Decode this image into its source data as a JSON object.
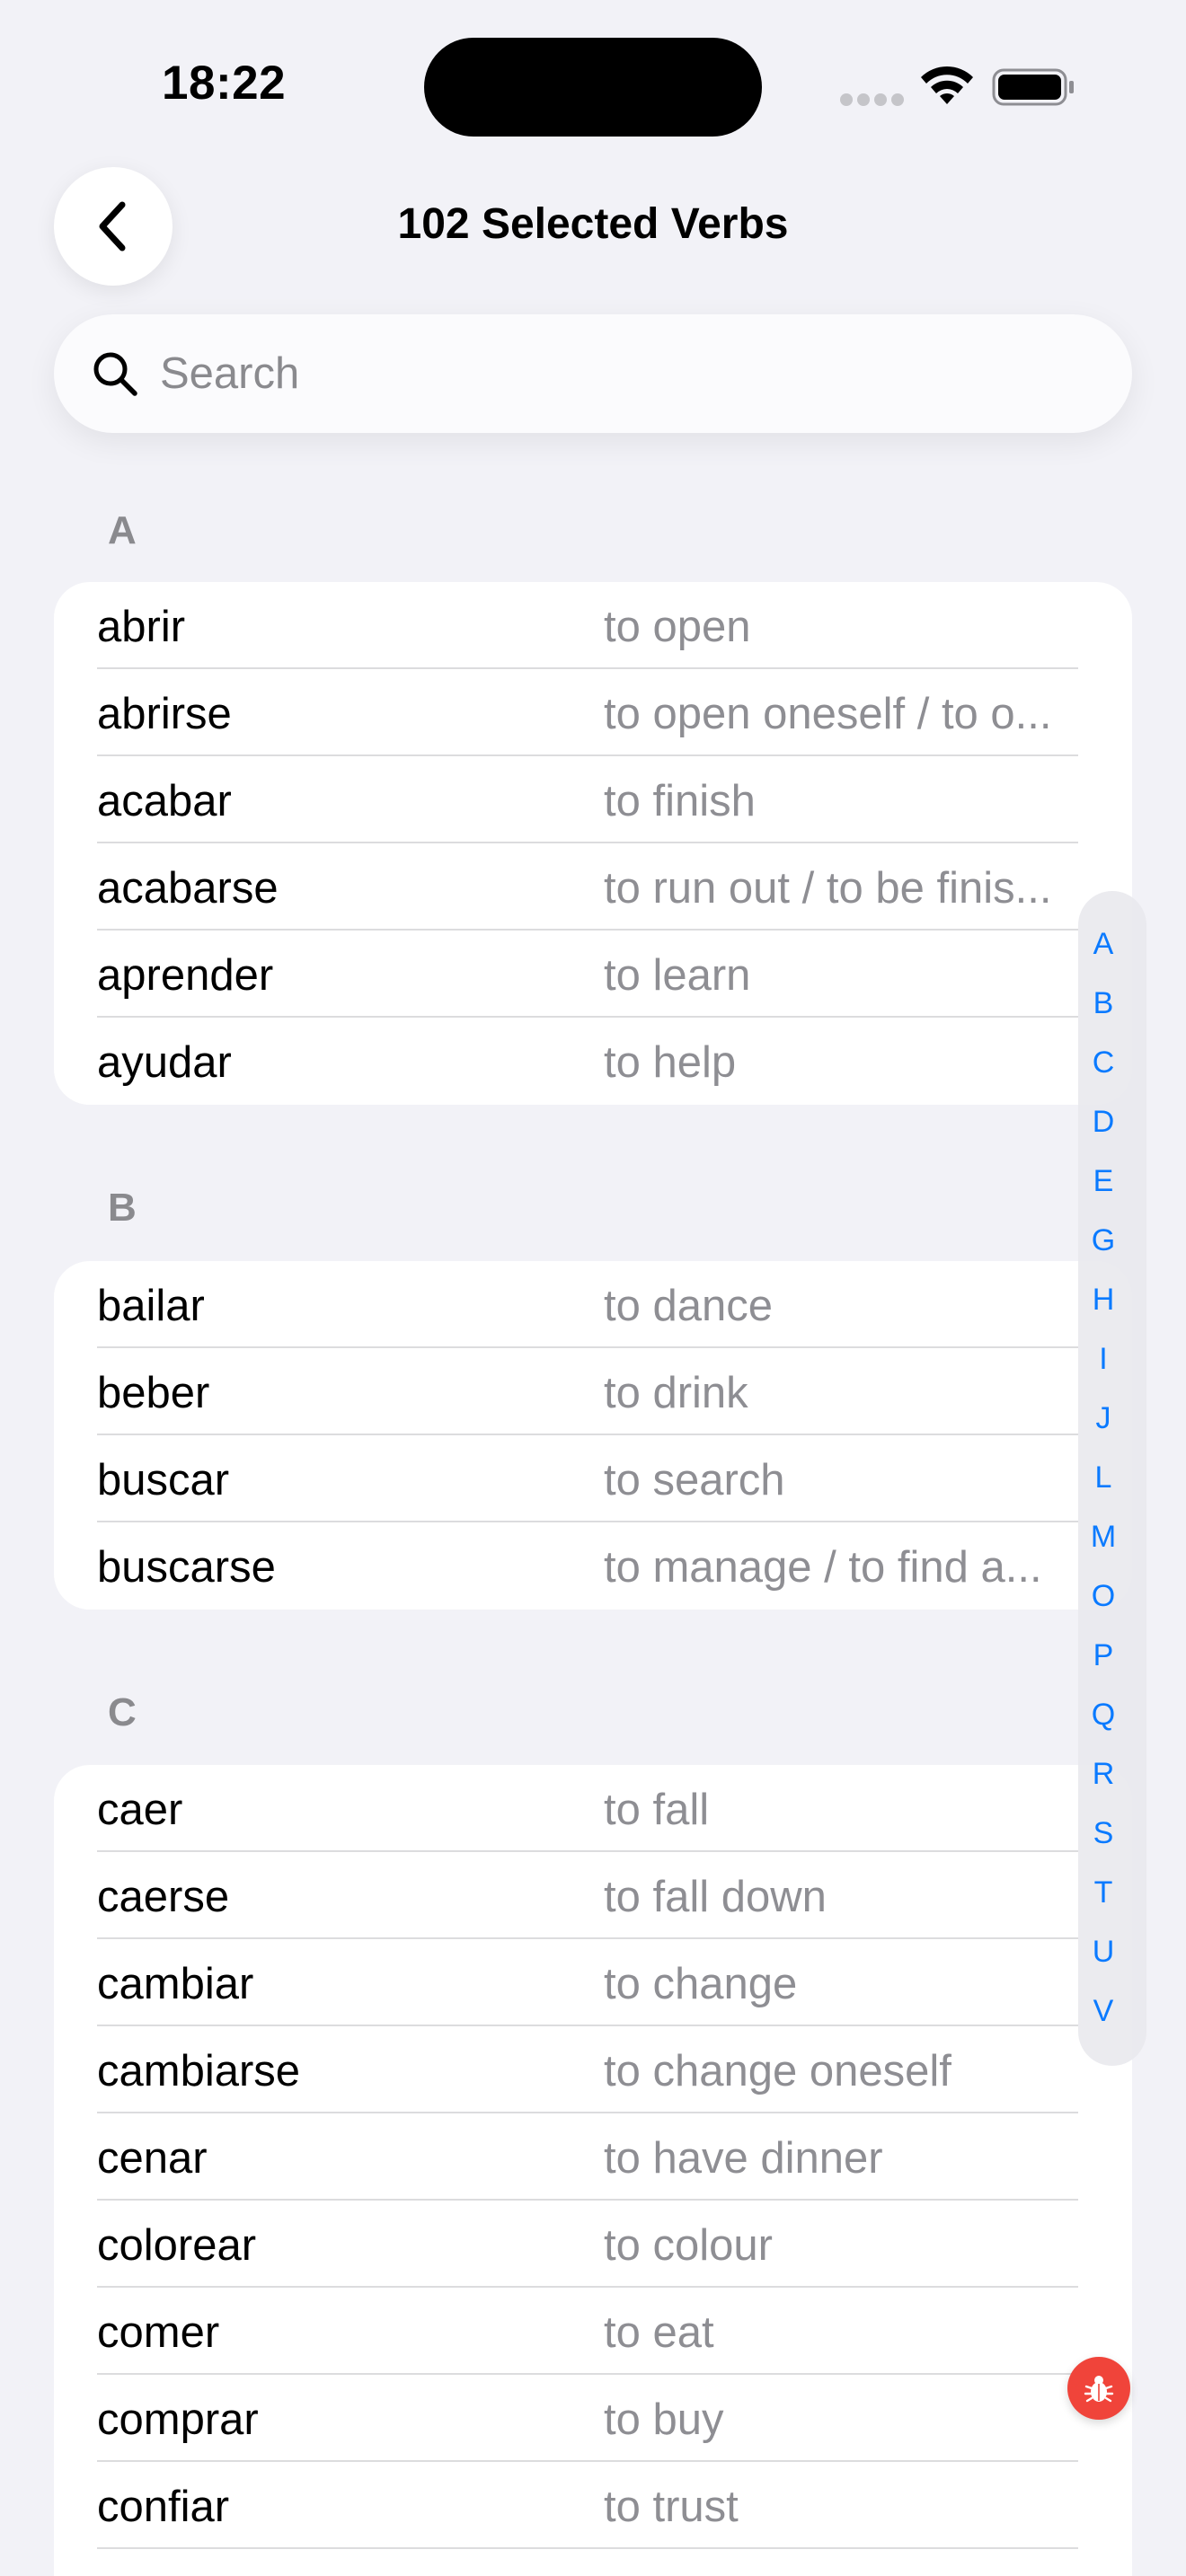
{
  "status": {
    "time": "18:22"
  },
  "nav": {
    "title": "102 Selected Verbs"
  },
  "search": {
    "placeholder": "Search"
  },
  "sections": [
    {
      "letter": "A",
      "rows": [
        {
          "verb": "abrir",
          "meaning": "to open"
        },
        {
          "verb": "abrirse",
          "meaning": "to open oneself / to o..."
        },
        {
          "verb": "acabar",
          "meaning": "to finish"
        },
        {
          "verb": "acabarse",
          "meaning": "to run out / to be finis..."
        },
        {
          "verb": "aprender",
          "meaning": "to learn"
        },
        {
          "verb": "ayudar",
          "meaning": "to help"
        }
      ]
    },
    {
      "letter": "B",
      "rows": [
        {
          "verb": "bailar",
          "meaning": "to dance"
        },
        {
          "verb": "beber",
          "meaning": "to drink"
        },
        {
          "verb": "buscar",
          "meaning": "to search"
        },
        {
          "verb": "buscarse",
          "meaning": "to manage / to find a..."
        }
      ]
    },
    {
      "letter": "C",
      "rows": [
        {
          "verb": "caer",
          "meaning": "to fall"
        },
        {
          "verb": "caerse",
          "meaning": "to fall down"
        },
        {
          "verb": "cambiar",
          "meaning": "to change"
        },
        {
          "verb": "cambiarse",
          "meaning": "to change oneself"
        },
        {
          "verb": "cenar",
          "meaning": "to have dinner"
        },
        {
          "verb": "colorear",
          "meaning": "to colour"
        },
        {
          "verb": "comer",
          "meaning": "to eat"
        },
        {
          "verb": "comprar",
          "meaning": "to buy"
        },
        {
          "verb": "confiar",
          "meaning": "to trust"
        }
      ]
    }
  ],
  "index_letters": [
    "A",
    "B",
    "C",
    "D",
    "E",
    "G",
    "H",
    "I",
    "J",
    "L",
    "M",
    "O",
    "P",
    "Q",
    "R",
    "S",
    "T",
    "U",
    "V"
  ],
  "colors": {
    "accent": "#0a7aff",
    "secondary_text": "#8e8e93",
    "background": "#f2f2f7",
    "debug_button": "#f0443a"
  },
  "icons": {
    "back": "chevron-left-icon",
    "search": "search-icon",
    "debug": "bug-icon",
    "wifi": "wifi-icon",
    "battery": "battery-icon"
  }
}
